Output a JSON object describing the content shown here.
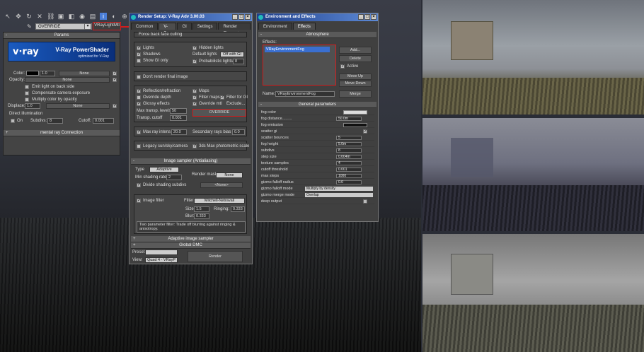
{
  "toolbar": {
    "icons": [
      "select-icon",
      "move-icon",
      "rotate-icon",
      "delete-icon",
      "link-icon",
      "render-icon",
      "snap-icon",
      "material-icon",
      "render-setup-icon",
      "info-icon",
      "environment-icon",
      "zoom-icon"
    ],
    "override_select": "OVERRIDE",
    "override_value": "VRayLightMtl"
  },
  "params": {
    "title": "Params",
    "logo_brand": "v·ray",
    "logo_title": "V-Ray PowerShader",
    "logo_subtitle": "optimized for V-Ray",
    "color_label": "Color:",
    "color_value": "1.0",
    "color_none": "None",
    "opacity_label": "Opacity:",
    "opacity_none": "None",
    "emit_back": "Emit light on back side",
    "comp_exposure": "Compensate camera exposure",
    "mult_opacity": "Multiply color by opacity",
    "displace_label": "Displace:",
    "displace_value": "1.0",
    "displace_none": "None",
    "direct_label": "Direct illumination",
    "on_label": "On",
    "subdivs_label": "Subdivs:",
    "subdivs_value": "8",
    "cutoff_label": "Cutoff:",
    "cutoff_value": "0.001",
    "mr_connection": "mental ray Connection"
  },
  "render_setup": {
    "title": "Render Setup: V-Ray Adv 3.00.03",
    "tabs": [
      "Common",
      "V-Ray",
      "GI",
      "Settings",
      "Render Elements"
    ],
    "force_back": "Force back face culling",
    "lights": "Lights",
    "hidden_lights": "Hidden lights",
    "shadows": "Shadows",
    "default_lights": "Default lights",
    "default_lights_val": "Off with GI",
    "show_gi": "Show GI only",
    "prob_lights": "Probabilistic lights",
    "prob_val": "8",
    "dont_render": "Don't render final image",
    "refl_refr": "Reflection/refraction",
    "maps": "Maps",
    "override_depth": "Override depth",
    "filter_maps": "Filter maps",
    "filter_gi": "Filter for GI",
    "glossy": "Glossy effects",
    "override_mtl": "Override mtl",
    "exclude": "Exclude...",
    "max_transp": "Max transp. levels",
    "max_transp_val": "50",
    "transp_cutoff": "Transp. cutoff",
    "transp_cutoff_val": "0.001",
    "override_btn": "OVERRIDE",
    "max_ray": "Max ray intens",
    "max_ray_val": "20.0",
    "secondary_bias": "Secondary rays bias",
    "secondary_bias_val": "0.0",
    "legacy_sun": "Legacy sun/sky/camera",
    "photometric": "3ds Max photometric scale",
    "image_sampler_title": "Image sampler (Antialiasing)",
    "type_label": "Type",
    "type_val": "Adaptive",
    "min_shading": "Min shading rate",
    "min_shading_val": "2",
    "render_mask": "Render mask",
    "render_mask_val": "None",
    "none_val": "<None>",
    "divide_subdivs": "Divide shading subdivs",
    "image_filter": "Image filter",
    "filter_label": "Filter",
    "filter_val": "Mitchell-Netravali",
    "size_label": "Size:",
    "size_val": "1.5",
    "ringing_label": "Ringing:",
    "ringing_val": "0.333",
    "blur_label": "Blur:",
    "blur_val": "0.333",
    "filter_desc": "Two parameter filter: Trade off blurring against ringing & anisotropy.",
    "adaptive_sampler": "Adaptive image sampler",
    "global_dmc": "Global DMC",
    "preset_label": "Preset:",
    "view_label": "View:",
    "view_val": "Quad 4 - VRayP",
    "render_btn": "Render"
  },
  "environment": {
    "title": "Environment and Effects",
    "tabs": [
      "Environment",
      "Effects"
    ],
    "atmosphere": "Atmosphere",
    "effects_label": "Effects:",
    "effect_item": "VRayEnvironmentFog",
    "add": "Add...",
    "delete": "Delete",
    "active": "Active",
    "move_up": "Move Up",
    "move_down": "Move Down",
    "name_label": "Name:",
    "name_val": "VRayEnvironmentFog",
    "merge": "Merge",
    "general": "General parameters",
    "fields": [
      [
        "fog color",
        ""
      ],
      [
        "fog distance",
        ".........",
        "50.0m"
      ],
      [
        "fog emission",
        ""
      ],
      [
        "scatter gi",
        ""
      ],
      [
        "scatter bounces",
        "",
        "5"
      ],
      [
        "fog height",
        "",
        "5.0m"
      ],
      [
        "subdivs",
        "",
        "8"
      ],
      [
        "step size",
        "",
        "0.004m"
      ],
      [
        "texture samples",
        "",
        "4"
      ],
      [
        "cutoff threshold",
        "",
        "0.001"
      ],
      [
        "max steps",
        "",
        "1000"
      ],
      [
        "gizmo falloff radius",
        "",
        "0.0"
      ],
      [
        "gizmo falloff mode",
        "Multiply by density"
      ],
      [
        "gizmo merge mode",
        "Overlap"
      ],
      [
        "deep output",
        ""
      ]
    ]
  }
}
